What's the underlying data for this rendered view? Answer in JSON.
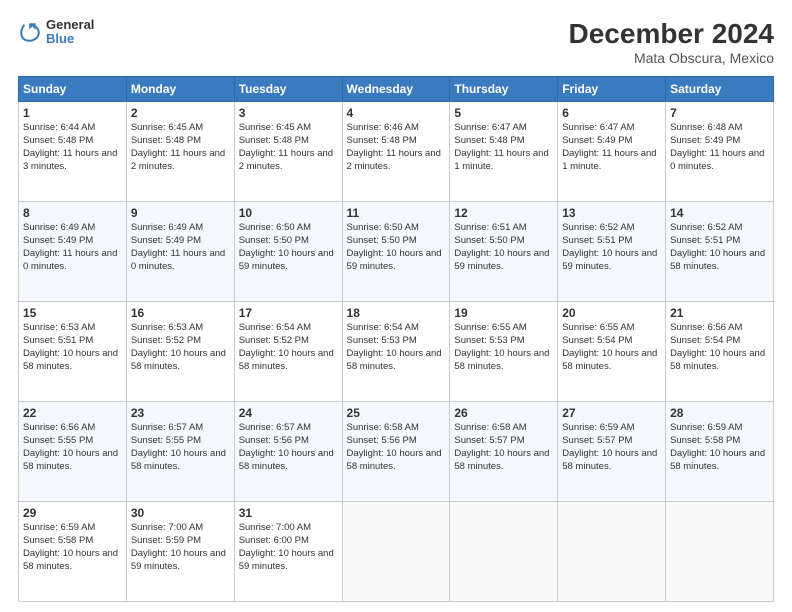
{
  "header": {
    "logo_line1": "General",
    "logo_line2": "Blue",
    "title": "December 2024",
    "subtitle": "Mata Obscura, Mexico"
  },
  "days_of_week": [
    "Sunday",
    "Monday",
    "Tuesday",
    "Wednesday",
    "Thursday",
    "Friday",
    "Saturday"
  ],
  "weeks": [
    [
      {
        "day": "1",
        "sunrise": "6:44 AM",
        "sunset": "5:48 PM",
        "daylight": "11 hours and 3 minutes."
      },
      {
        "day": "2",
        "sunrise": "6:45 AM",
        "sunset": "5:48 PM",
        "daylight": "11 hours and 2 minutes."
      },
      {
        "day": "3",
        "sunrise": "6:45 AM",
        "sunset": "5:48 PM",
        "daylight": "11 hours and 2 minutes."
      },
      {
        "day": "4",
        "sunrise": "6:46 AM",
        "sunset": "5:48 PM",
        "daylight": "11 hours and 2 minutes."
      },
      {
        "day": "5",
        "sunrise": "6:47 AM",
        "sunset": "5:48 PM",
        "daylight": "11 hours and 1 minute."
      },
      {
        "day": "6",
        "sunrise": "6:47 AM",
        "sunset": "5:49 PM",
        "daylight": "11 hours and 1 minute."
      },
      {
        "day": "7",
        "sunrise": "6:48 AM",
        "sunset": "5:49 PM",
        "daylight": "11 hours and 0 minutes."
      }
    ],
    [
      {
        "day": "8",
        "sunrise": "6:49 AM",
        "sunset": "5:49 PM",
        "daylight": "11 hours and 0 minutes."
      },
      {
        "day": "9",
        "sunrise": "6:49 AM",
        "sunset": "5:49 PM",
        "daylight": "11 hours and 0 minutes."
      },
      {
        "day": "10",
        "sunrise": "6:50 AM",
        "sunset": "5:50 PM",
        "daylight": "10 hours and 59 minutes."
      },
      {
        "day": "11",
        "sunrise": "6:50 AM",
        "sunset": "5:50 PM",
        "daylight": "10 hours and 59 minutes."
      },
      {
        "day": "12",
        "sunrise": "6:51 AM",
        "sunset": "5:50 PM",
        "daylight": "10 hours and 59 minutes."
      },
      {
        "day": "13",
        "sunrise": "6:52 AM",
        "sunset": "5:51 PM",
        "daylight": "10 hours and 59 minutes."
      },
      {
        "day": "14",
        "sunrise": "6:52 AM",
        "sunset": "5:51 PM",
        "daylight": "10 hours and 58 minutes."
      }
    ],
    [
      {
        "day": "15",
        "sunrise": "6:53 AM",
        "sunset": "5:51 PM",
        "daylight": "10 hours and 58 minutes."
      },
      {
        "day": "16",
        "sunrise": "6:53 AM",
        "sunset": "5:52 PM",
        "daylight": "10 hours and 58 minutes."
      },
      {
        "day": "17",
        "sunrise": "6:54 AM",
        "sunset": "5:52 PM",
        "daylight": "10 hours and 58 minutes."
      },
      {
        "day": "18",
        "sunrise": "6:54 AM",
        "sunset": "5:53 PM",
        "daylight": "10 hours and 58 minutes."
      },
      {
        "day": "19",
        "sunrise": "6:55 AM",
        "sunset": "5:53 PM",
        "daylight": "10 hours and 58 minutes."
      },
      {
        "day": "20",
        "sunrise": "6:55 AM",
        "sunset": "5:54 PM",
        "daylight": "10 hours and 58 minutes."
      },
      {
        "day": "21",
        "sunrise": "6:56 AM",
        "sunset": "5:54 PM",
        "daylight": "10 hours and 58 minutes."
      }
    ],
    [
      {
        "day": "22",
        "sunrise": "6:56 AM",
        "sunset": "5:55 PM",
        "daylight": "10 hours and 58 minutes."
      },
      {
        "day": "23",
        "sunrise": "6:57 AM",
        "sunset": "5:55 PM",
        "daylight": "10 hours and 58 minutes."
      },
      {
        "day": "24",
        "sunrise": "6:57 AM",
        "sunset": "5:56 PM",
        "daylight": "10 hours and 58 minutes."
      },
      {
        "day": "25",
        "sunrise": "6:58 AM",
        "sunset": "5:56 PM",
        "daylight": "10 hours and 58 minutes."
      },
      {
        "day": "26",
        "sunrise": "6:58 AM",
        "sunset": "5:57 PM",
        "daylight": "10 hours and 58 minutes."
      },
      {
        "day": "27",
        "sunrise": "6:59 AM",
        "sunset": "5:57 PM",
        "daylight": "10 hours and 58 minutes."
      },
      {
        "day": "28",
        "sunrise": "6:59 AM",
        "sunset": "5:58 PM",
        "daylight": "10 hours and 58 minutes."
      }
    ],
    [
      {
        "day": "29",
        "sunrise": "6:59 AM",
        "sunset": "5:58 PM",
        "daylight": "10 hours and 58 minutes."
      },
      {
        "day": "30",
        "sunrise": "7:00 AM",
        "sunset": "5:59 PM",
        "daylight": "10 hours and 59 minutes."
      },
      {
        "day": "31",
        "sunrise": "7:00 AM",
        "sunset": "6:00 PM",
        "daylight": "10 hours and 59 minutes."
      },
      null,
      null,
      null,
      null
    ]
  ]
}
